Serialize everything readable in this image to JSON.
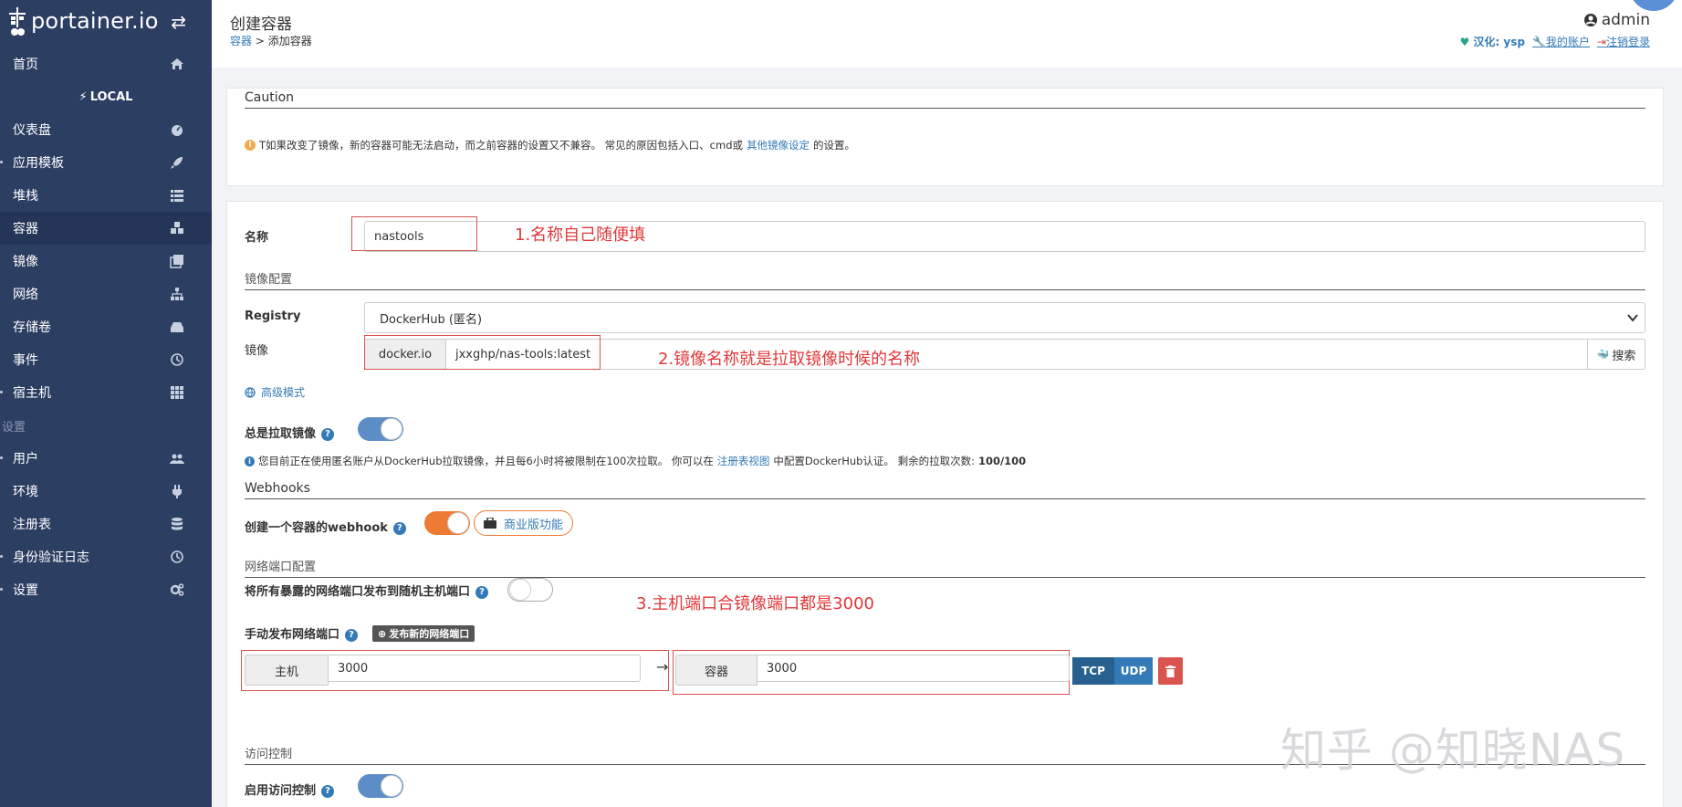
{
  "sidebar": {
    "brand": "portainer.io",
    "home": "首页",
    "local": "LOCAL",
    "items": [
      {
        "label": "仪表盘",
        "icon": "dashboard-icon"
      },
      {
        "label": "应用模板",
        "icon": "rocket-icon"
      },
      {
        "label": "堆栈",
        "icon": "list-icon"
      },
      {
        "label": "容器",
        "icon": "cubes-icon"
      },
      {
        "label": "镜像",
        "icon": "clone-icon"
      },
      {
        "label": "网络",
        "icon": "sitemap-icon"
      },
      {
        "label": "存储卷",
        "icon": "hdd-icon"
      },
      {
        "label": "事件",
        "icon": "history-icon"
      },
      {
        "label": "宿主机",
        "icon": "th-icon"
      }
    ],
    "settings_heading": "设置",
    "settings_items": [
      {
        "label": "用户",
        "icon": "users-icon"
      },
      {
        "label": "环境",
        "icon": "plug-icon"
      },
      {
        "label": "注册表",
        "icon": "database-icon"
      },
      {
        "label": "身份验证日志",
        "icon": "history-icon"
      },
      {
        "label": "设置",
        "icon": "cogs-icon"
      }
    ]
  },
  "header": {
    "title": "创建容器",
    "breadcrumb_link": "容器",
    "breadcrumb_sep": ">",
    "breadcrumb_current": "添加容器",
    "user": "admin",
    "han": "汉化: ysp",
    "my_account": "我的账户",
    "logout": "注销登录"
  },
  "caution": {
    "title": "Caution",
    "text_before": "T如果改变了镜像，新的容器可能无法启动，而之前容器的设置又不兼容。 常见的原因包括入口、cmd或",
    "link": "其他镜像设定",
    "text_after": "的设置。"
  },
  "form": {
    "name_label": "名称",
    "name_value": "nastools",
    "name_annotation": "1.名称自己随便填",
    "image_config_title": "镜像配置",
    "registry_label": "Registry",
    "registry_value": "DockerHub (匿名)",
    "image_label": "镜像",
    "image_prefix": "docker.io",
    "image_value": "jxxghp/nas-tools:latest",
    "image_annotation": "2.镜像名称就是拉取镜像时候的名称",
    "search_button": "搜索",
    "advanced_mode": "高级模式",
    "always_pull_label": "总是拉取镜像",
    "dockerhub_info_before": "您目前正在使用匿名账户从DockerHub拉取镜像，并且每6小时将被限制在100次拉取。 你可以在",
    "dockerhub_info_link": "注册表视图",
    "dockerhub_info_after": "中配置DockerHub认证。 剩余的拉取次数:",
    "dockerhub_remaining": "100/100",
    "webhooks_title": "Webhooks",
    "webhook_label": "创建一个容器的webhook",
    "business_feature": "商业版功能",
    "port_config_title": "网络端口配置",
    "publish_all_label": "将所有暴露的网络端口发布到随机主机端口",
    "port_annotation": "3.主机端口合镜像端口都是3000",
    "manual_publish_label": "手动发布网络端口",
    "publish_new_button": "发布新的网络端口",
    "host_addon": "主机",
    "host_port": "3000",
    "arrow": "→",
    "container_addon": "容器",
    "container_port": "3000",
    "tcp": "TCP",
    "udp": "UDP",
    "access_control_title": "访问控制",
    "enable_access_label": "启用访问控制"
  },
  "watermark": "知乎 @知晓NAS"
}
